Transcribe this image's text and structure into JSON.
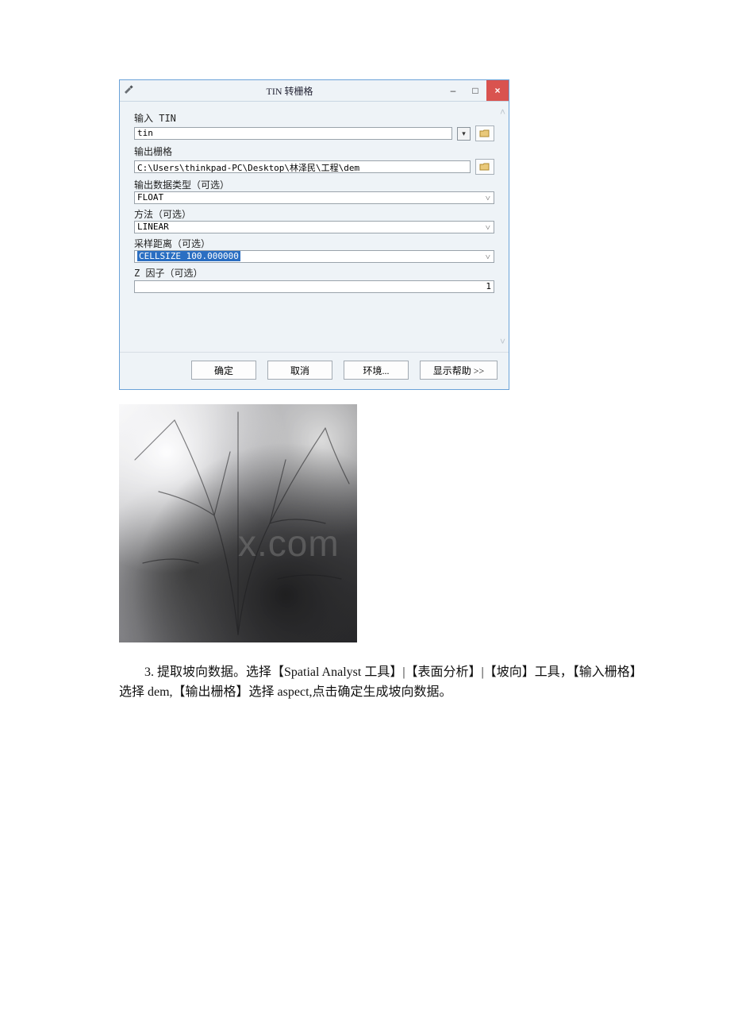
{
  "dialog": {
    "title": "TIN 转栅格",
    "fields": {
      "input_tin_label": "输入 TIN",
      "input_tin_value": "tin",
      "output_raster_label": "输出栅格",
      "output_raster_value": "C:\\Users\\thinkpad-PC\\Desktop\\林泽民\\工程\\dem",
      "data_type_label": "输出数据类型（可选）",
      "data_type_value": "FLOAT",
      "method_label": "方法（可选）",
      "method_value": "LINEAR",
      "sampling_label": "采样距离（可选）",
      "sampling_value": "CELLSIZE 100.000000",
      "z_factor_label": "Z 因子（可选）",
      "z_factor_value": "1"
    },
    "buttons": {
      "ok": "确定",
      "cancel": "取消",
      "env": "环境...",
      "help": "显示帮助 >>"
    },
    "window_controls": {
      "minimize": "–",
      "maximize": "□",
      "close": "×"
    }
  },
  "watermark": "x.com",
  "paragraph_text": "3. 提取坡向数据。选择【Spatial Analyst 工具】|【表面分析】|【坡向】工具，【输入栅格】选择 dem,【输出栅格】选择 aspect,点击确定生成坡向数据。"
}
